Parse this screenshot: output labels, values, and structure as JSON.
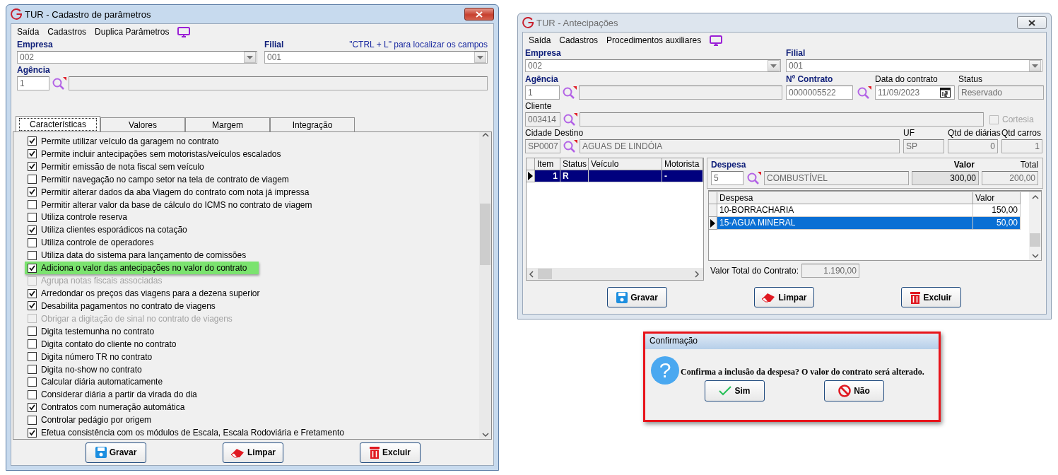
{
  "param_window": {
    "title": "TUR - Cadastro de parâmetros",
    "menu": [
      "Saída",
      "Cadastros",
      "Duplica Parâmetros"
    ],
    "empresa": {
      "label": "Empresa",
      "code": "002"
    },
    "filial": {
      "label": "Filial",
      "code": "001"
    },
    "hint": "\"CTRL + L\" para localizar os campos",
    "agencia": {
      "label": "Agência",
      "code": "1"
    },
    "tabs": [
      {
        "label": "Características",
        "selected": true
      },
      {
        "label": "Valores",
        "selected": false
      },
      {
        "label": "Margem",
        "selected": false
      },
      {
        "label": "Integração",
        "selected": false
      }
    ],
    "options": [
      {
        "label": "Permite utilizar veículo da garagem no contrato",
        "checked": true,
        "disabled": false,
        "highlighted": false
      },
      {
        "label": "Permite incluir antecipações sem motoristas/veículos escalados",
        "checked": true,
        "disabled": false,
        "highlighted": false
      },
      {
        "label": "Permitir emissão de nota fiscal sem veículo",
        "checked": true,
        "disabled": false,
        "highlighted": false
      },
      {
        "label": "Permitir navegação no campo setor na tela de contrato de viagem",
        "checked": false,
        "disabled": false,
        "highlighted": false
      },
      {
        "label": "Permitir alterar dados da aba Viagem do contrato com nota já impressa",
        "checked": true,
        "disabled": false,
        "highlighted": false
      },
      {
        "label": "Permitir alterar valor da base de cálculo do ICMS no contrato de viagem",
        "checked": false,
        "disabled": false,
        "highlighted": false
      },
      {
        "label": "Utiliza controle reserva",
        "checked": false,
        "disabled": false,
        "highlighted": false
      },
      {
        "label": "Utiliza clientes esporádicos na cotação",
        "checked": true,
        "disabled": false,
        "highlighted": false
      },
      {
        "label": "Utiliza controle de operadores",
        "checked": false,
        "disabled": false,
        "highlighted": false
      },
      {
        "label": "Utiliza data do sistema para lançamento de comissões",
        "checked": false,
        "disabled": false,
        "highlighted": false
      },
      {
        "label": "Adiciona o valor das antecipações no valor do contrato",
        "checked": true,
        "disabled": false,
        "highlighted": true
      },
      {
        "label": "Agrupa notas fiscais associadas",
        "checked": false,
        "disabled": true,
        "highlighted": false
      },
      {
        "label": "Arredondar os preços das viagens para a dezena superior",
        "checked": true,
        "disabled": false,
        "highlighted": false
      },
      {
        "label": "Desabilita pagamentos no contrato de viagens",
        "checked": true,
        "disabled": false,
        "highlighted": false
      },
      {
        "label": "Obrigar a digitação de sinal no contrato de viagens",
        "checked": false,
        "disabled": true,
        "highlighted": false
      },
      {
        "label": "Digita testemunha no contrato",
        "checked": false,
        "disabled": false,
        "highlighted": false
      },
      {
        "label": "Digita contato do cliente no contrato",
        "checked": false,
        "disabled": false,
        "highlighted": false
      },
      {
        "label": "Digita número TR no contrato",
        "checked": false,
        "disabled": false,
        "highlighted": false
      },
      {
        "label": "Digita no-show no contrato",
        "checked": false,
        "disabled": false,
        "highlighted": false
      },
      {
        "label": "Calcular diária automaticamente",
        "checked": false,
        "disabled": false,
        "highlighted": false
      },
      {
        "label": "Considerar diária a partir da virada do dia",
        "checked": false,
        "disabled": false,
        "highlighted": false
      },
      {
        "label": "Contratos com numeração automática",
        "checked": true,
        "disabled": false,
        "highlighted": false
      },
      {
        "label": "Controlar pedágio por origem",
        "checked": false,
        "disabled": false,
        "highlighted": false
      },
      {
        "label": "Efetua consistência com os módulos de Escala, Escala Rodoviária e Fretamento",
        "checked": true,
        "disabled": false,
        "highlighted": false
      }
    ],
    "buttons": [
      {
        "label": "Gravar",
        "kind": "save"
      },
      {
        "label": "Limpar",
        "kind": "clear"
      },
      {
        "label": "Excluir",
        "kind": "delete"
      }
    ]
  },
  "antecipacoes_window": {
    "title": "TUR - Antecipações",
    "menu": [
      "Saída",
      "Cadastros",
      "Procedimentos auxiliares"
    ],
    "empresa": {
      "label": "Empresa",
      "code": "002"
    },
    "filial": {
      "label": "Filial",
      "code": "001"
    },
    "agencia": {
      "label": "Agência",
      "code": "1"
    },
    "contrato": {
      "label": "Nº Contrato",
      "value": "0000005522"
    },
    "data": {
      "label": "Data do contrato",
      "value": "11/09/2023"
    },
    "status": {
      "label": "Status",
      "value": "Reservado"
    },
    "cliente": {
      "label": "Cliente",
      "code": "003414"
    },
    "cortesia": {
      "label": "Cortesia",
      "checked": false,
      "disabled": true
    },
    "cidade": {
      "label": "Cidade Destino",
      "code": "SP0007",
      "name": "AGUAS DE LINDÓIA"
    },
    "uf": {
      "label": "UF",
      "value": "SP"
    },
    "diarias": {
      "label": "Qtd de diárias",
      "value": "0"
    },
    "carros": {
      "label": "Qtd carros",
      "value": "1"
    },
    "items_table": {
      "columns": [
        "Item",
        "Status",
        "Veículo",
        "Motorista"
      ],
      "rows": [
        {
          "item": "1",
          "status": "R",
          "motorista": "-",
          "selected": true
        }
      ]
    },
    "despesa": {
      "label": "Despesa",
      "code": "5",
      "name": "COMBUSTÍVEL",
      "valor_label": "Valor",
      "valor": "300,00",
      "total_label": "Total",
      "total": "200,00"
    },
    "despesas_table": {
      "columns": [
        "Despesa",
        "Valor"
      ],
      "rows": [
        {
          "despesa": "10-BORRACHARIA",
          "valor": "150,00",
          "selected": false
        },
        {
          "despesa": "15-AGUA MINERAL",
          "valor": "50,00",
          "selected": true
        }
      ]
    },
    "total_contrato": {
      "label": "Valor Total do Contrato:",
      "value": "1.190,00"
    },
    "buttons": [
      {
        "label": "Gravar",
        "kind": "save"
      },
      {
        "label": "Limpar",
        "kind": "clear"
      },
      {
        "label": "Excluir",
        "kind": "delete"
      }
    ]
  },
  "confirm_dialog": {
    "title": "Confirmação",
    "icon_char": "?",
    "message": "Confirma a inclusão da despesa? O valor do contrato será alterado.",
    "buttons": [
      {
        "label": "Sim",
        "kind": "yes"
      },
      {
        "label": "Não",
        "kind": "no"
      }
    ]
  }
}
